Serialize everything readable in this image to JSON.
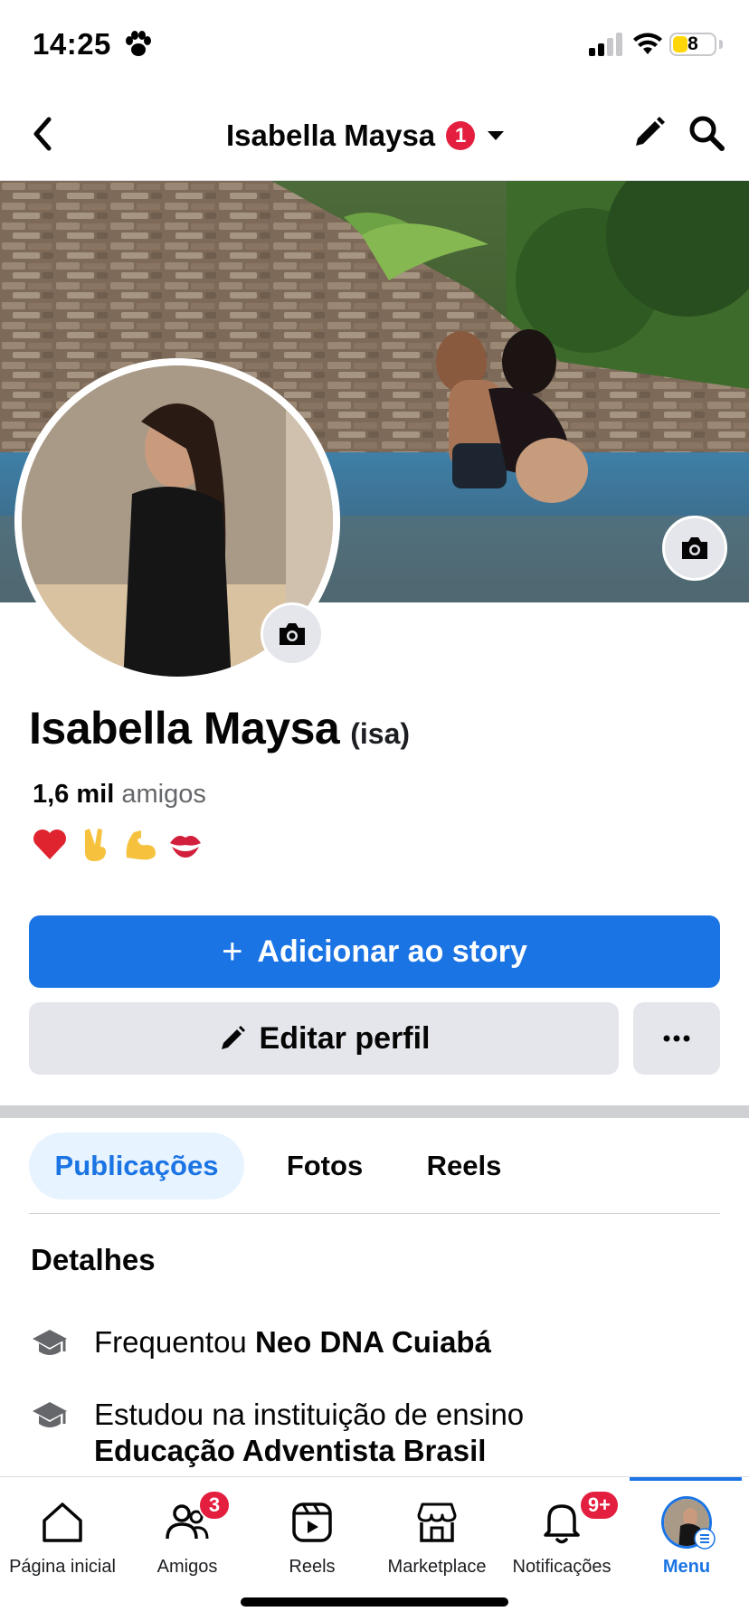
{
  "status_bar": {
    "time": "14:25",
    "battery": "8"
  },
  "header": {
    "title": "Isabella Maysa",
    "badge": "1"
  },
  "profile": {
    "name": "Isabella Maysa",
    "nickname": "(isa)",
    "friends_count": "1,6 mil",
    "friends_label": "amigos",
    "bio_emojis": [
      "heart-emoji",
      "victory-hand-emoji",
      "flexed-biceps-emoji",
      "kiss-mark-emoji"
    ]
  },
  "actions": {
    "add_story_label": "Adicionar ao story",
    "edit_profile_label": "Editar perfil"
  },
  "tabs": [
    {
      "label": "Publicações",
      "active": true
    },
    {
      "label": "Fotos",
      "active": false
    },
    {
      "label": "Reels",
      "active": false
    }
  ],
  "details": {
    "title": "Detalhes",
    "items": [
      {
        "prefix": "Frequentou",
        "strong": "Neo DNA Cuiabá",
        "icon": "graduation-cap-icon"
      },
      {
        "prefix": "Estudou na instituição de ensino",
        "strong": "Educação Adventista Brasil",
        "icon": "graduation-cap-icon"
      }
    ]
  },
  "tabbar": [
    {
      "label": "Página inicial",
      "icon": "home-icon"
    },
    {
      "label": "Amigos",
      "icon": "friends-icon",
      "badge": "3"
    },
    {
      "label": "Reels",
      "icon": "reels-icon"
    },
    {
      "label": "Marketplace",
      "icon": "marketplace-icon"
    },
    {
      "label": "Notificações",
      "icon": "bell-icon",
      "badge": "9+"
    },
    {
      "label": "Menu",
      "icon": "menu-avatar",
      "active": true
    }
  ],
  "colors": {
    "accent": "#1b74e4",
    "badge": "#e41e3f",
    "button_gray": "#e4e6eb"
  }
}
